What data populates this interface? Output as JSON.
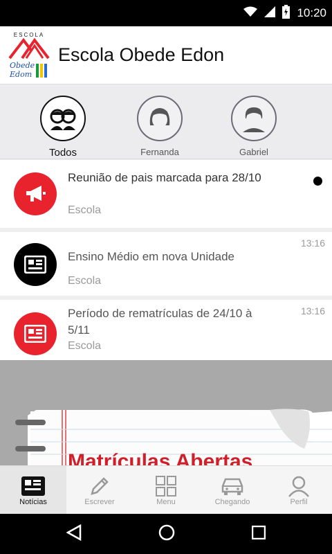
{
  "status_bar": {
    "time": "10:20"
  },
  "app": {
    "title": "Escola Obede Edon",
    "logo": {
      "top_text": "ESCOLA",
      "script_text_1": "Obede",
      "script_text_2": "Edom"
    }
  },
  "filters": [
    {
      "label": "Todos",
      "icon": "group-icon",
      "active": true
    },
    {
      "label": "Fernanda",
      "icon": "girl-avatar-icon",
      "active": false
    },
    {
      "label": "Gabriel",
      "icon": "boy-avatar-icon",
      "active": false
    }
  ],
  "feed": [
    {
      "title": "Reunião de pais marcada para 28/10",
      "source": "Escola",
      "time": "",
      "icon": "megaphone-icon",
      "icon_color": "#e8232e",
      "unread": true
    },
    {
      "title": "Ensino Médio em nova Unidade",
      "source": "Escola",
      "time": "13:16",
      "icon": "newspaper-icon",
      "icon_color": "#000000",
      "unread": false
    },
    {
      "title": "Período de rematrículas de 24/10 à 5/11",
      "source": "Escola",
      "time": "13:16",
      "icon": "newspaper-icon",
      "icon_color": "#e8232e",
      "unread": false
    }
  ],
  "banner": {
    "text": "Matrículas Abertas"
  },
  "bottom_nav": [
    {
      "label": "Notícias",
      "icon": "newspaper-icon",
      "active": true
    },
    {
      "label": "Escrever",
      "icon": "pencil-icon",
      "active": false
    },
    {
      "label": "Menu",
      "icon": "grid-icon",
      "active": false
    },
    {
      "label": "Chegando",
      "icon": "car-icon",
      "active": false
    },
    {
      "label": "Perfil",
      "icon": "person-icon",
      "active": false
    }
  ],
  "colors": {
    "accent_red": "#e8232e",
    "title_text": "#333333",
    "muted_text": "#9a9a9a"
  }
}
